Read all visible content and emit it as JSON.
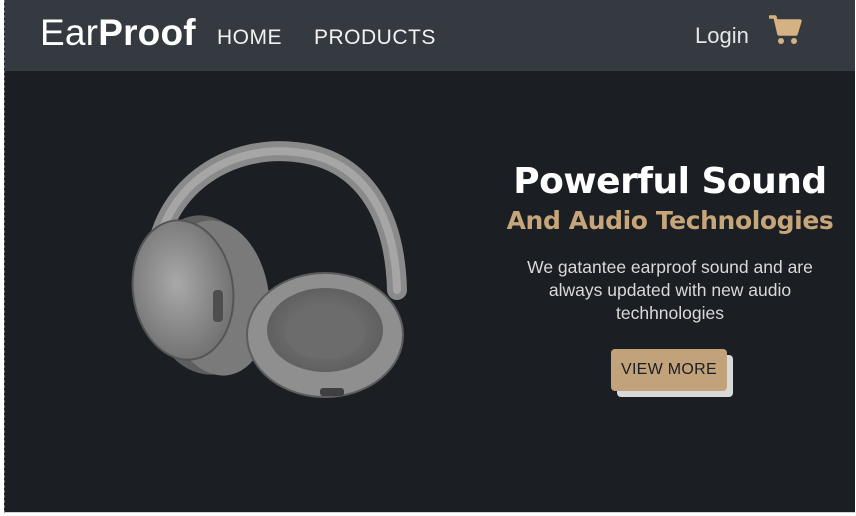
{
  "brand": {
    "light": "Ear",
    "bold": "Proof"
  },
  "nav": {
    "home": "HOME",
    "products": "PRODUCTS",
    "login": "Login"
  },
  "icons": {
    "cart": "shopping-cart-icon"
  },
  "hero": {
    "headline": "Powerful Sound",
    "subheadline": "And Audio Technologies",
    "description": "We gatantee earproof sound and are always updated with new audio techhnologies",
    "button": "VIEW MORE"
  },
  "colors": {
    "navbar": "#353a41",
    "background": "#1b1e22",
    "accent": "#c2a27a",
    "cart": "#d4b284"
  }
}
